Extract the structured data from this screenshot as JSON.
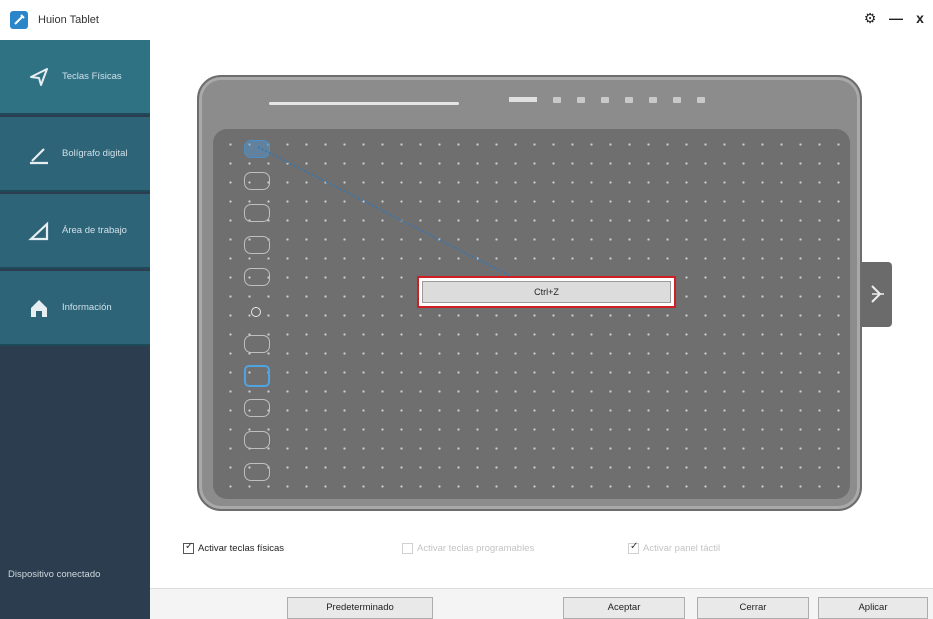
{
  "window": {
    "title": "Huion Tablet",
    "settings_glyph": "⚙",
    "minimize_glyph": "—",
    "close_glyph": "x"
  },
  "sidebar": {
    "items": [
      {
        "label": "Teclas Físicas",
        "icon": "send-arrow-icon",
        "active": true
      },
      {
        "label": "Bolígrafo digital",
        "icon": "pen-icon",
        "active": false
      },
      {
        "label": "Área de trabajo",
        "icon": "triangle-area-icon",
        "active": false
      },
      {
        "label": "Información",
        "icon": "home-icon",
        "active": false
      }
    ],
    "footer": "Dispositivo conectado"
  },
  "tablet": {
    "express_keys": 12,
    "selected_key": 1,
    "assignment_value": "Ctrl+Z"
  },
  "options": {
    "enable_keys": {
      "label": "Activar teclas físicas",
      "checked": true
    },
    "enable_prompt": {
      "label": "Activar teclas programables",
      "checked": false,
      "disabled": true
    },
    "enable_touch": {
      "label": "Activar panel táctil",
      "checked": true,
      "disabled": true
    }
  },
  "buttons": {
    "defaults": "Predeterminado",
    "accept": "Aceptar",
    "close": "Cerrar",
    "apply": "Aplicar"
  },
  "colors": {
    "sidebar": "#2b3d4e",
    "nav_item": "#2e6478",
    "highlight_border": "#cf1f25",
    "selection": "#4a8fc8"
  }
}
